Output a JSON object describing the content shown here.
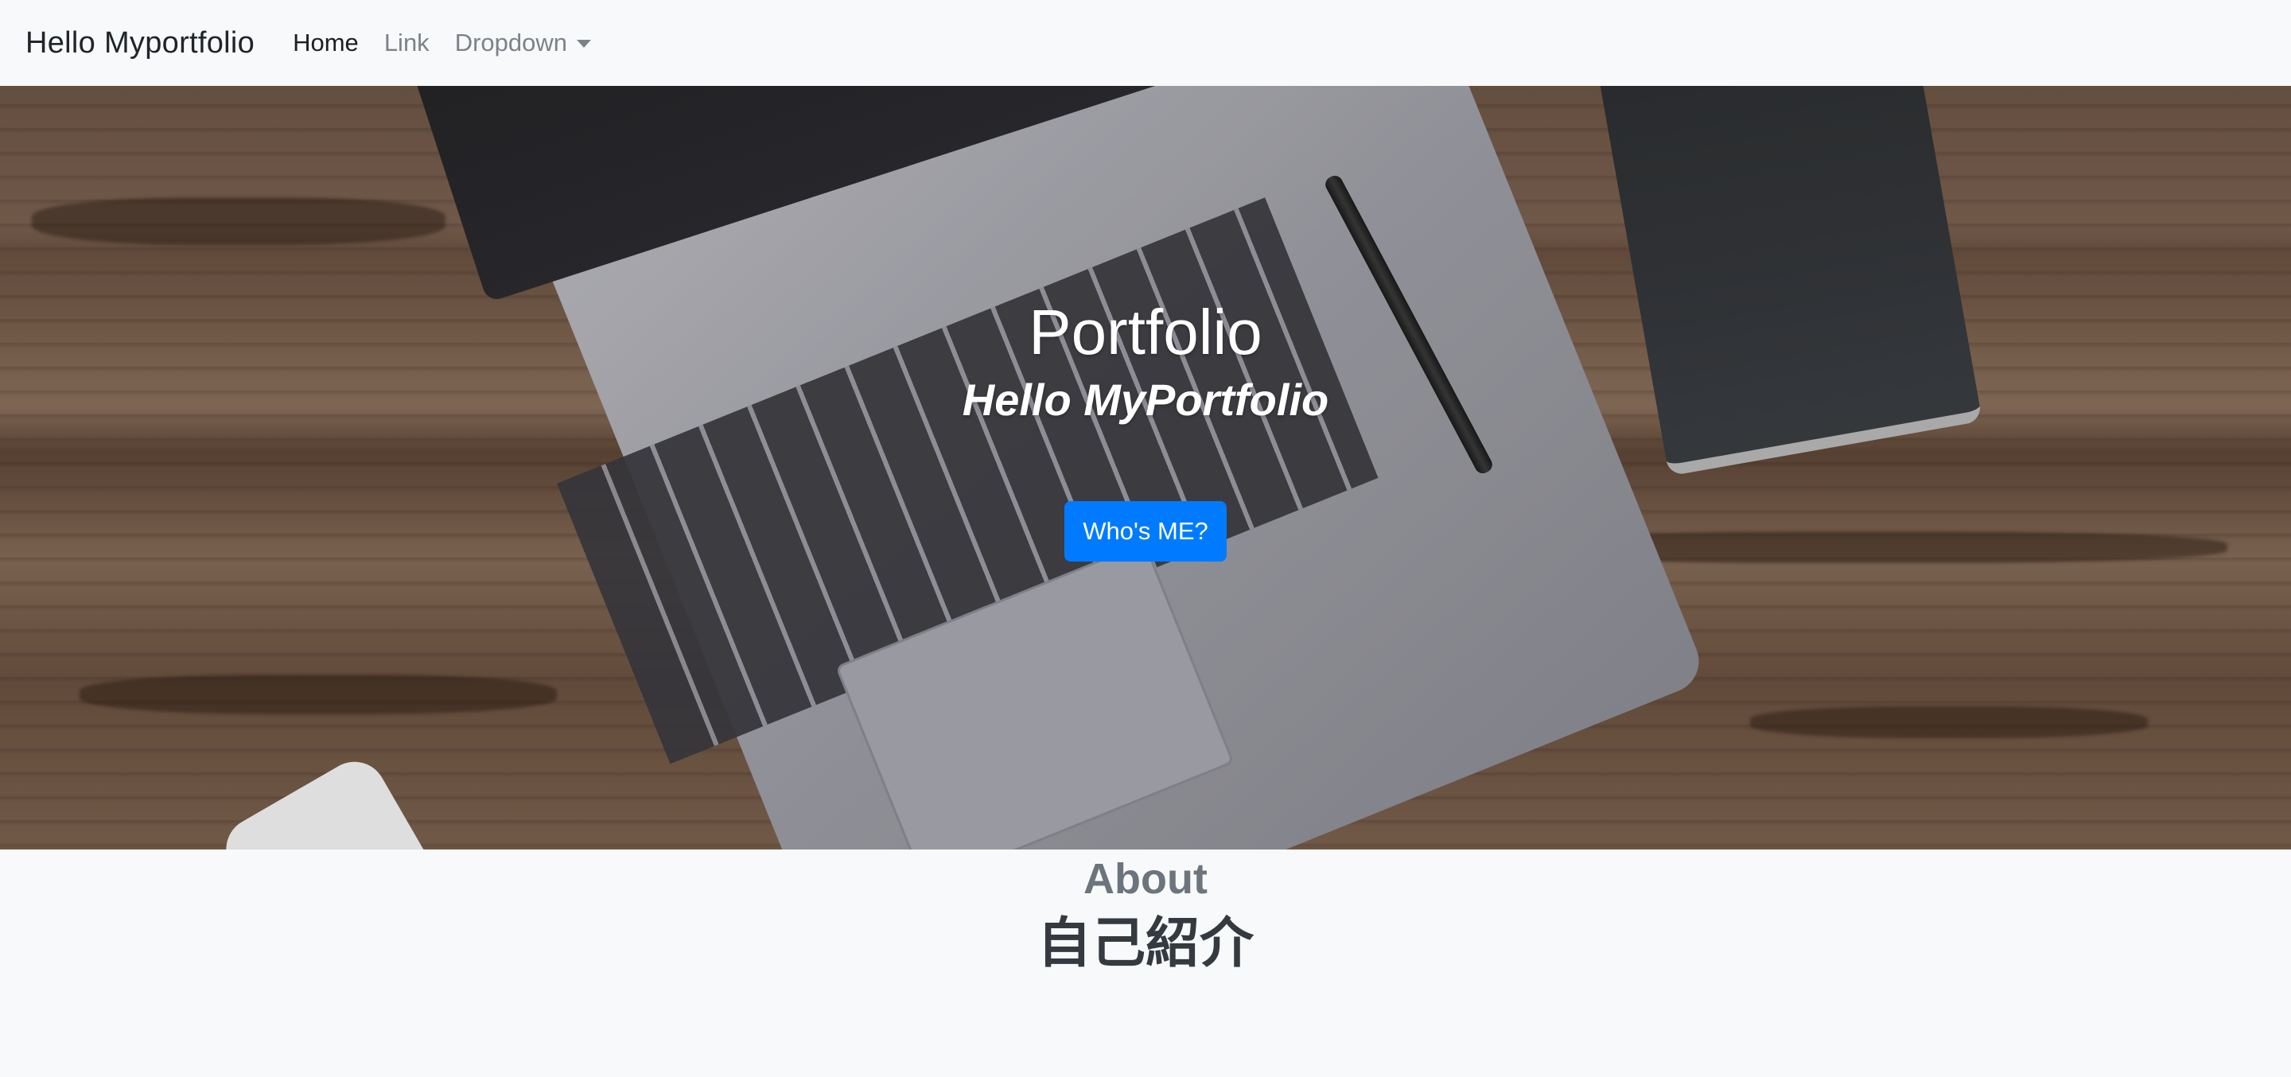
{
  "navbar": {
    "brand": "Hello Myportfolio",
    "links": [
      {
        "label": "Home",
        "active": true
      },
      {
        "label": "Link",
        "active": false
      },
      {
        "label": "Dropdown",
        "active": false,
        "dropdown": true
      }
    ]
  },
  "hero": {
    "title": "Portfolio",
    "subtitle": "Hello MyPortfolio",
    "button_label": "Who's ME?",
    "button_color": "#007bff"
  },
  "about": {
    "title": "About",
    "subtitle": "自己紹介"
  },
  "colors": {
    "background": "#f8f9fa",
    "nav_muted": "#7d8289",
    "about_title": "#6c757d"
  },
  "icons": {
    "dropdown": "caret-down-icon"
  }
}
